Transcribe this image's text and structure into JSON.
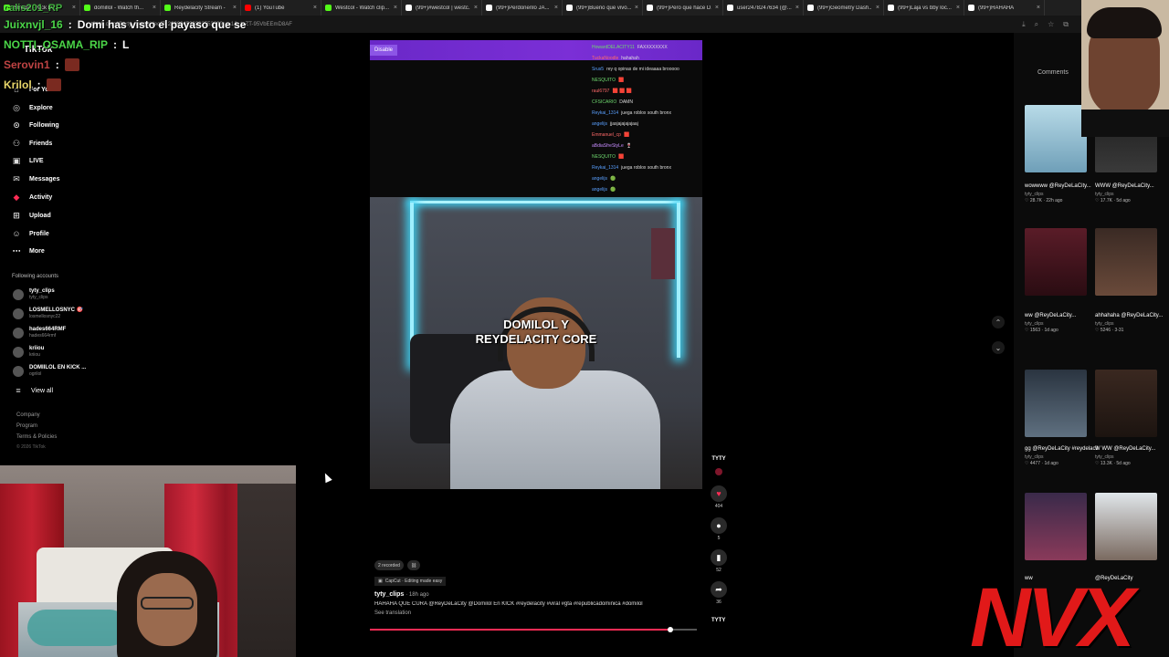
{
  "browser": {
    "tabs": [
      {
        "label": "Stream - Kick D...",
        "color": "#53fc18"
      },
      {
        "label": "domillol - Watch th...",
        "color": "#53fc18"
      },
      {
        "label": "Reydelacity Stream -",
        "color": "#53fc18"
      },
      {
        "label": "(1) YouTube",
        "color": "#ff0000"
      },
      {
        "label": "Westcol - Watch clip...",
        "color": "#53fc18"
      },
      {
        "label": "(99+)#westcol | westc...",
        "color": "#ffffff"
      },
      {
        "label": "(99+)Perdonenlo JA...",
        "color": "#ffffff"
      },
      {
        "label": "(99+)Bueno que vivo...",
        "color": "#ffffff"
      },
      {
        "label": "(99+)Pero que hace D...",
        "color": "#ffffff"
      },
      {
        "label": "user2478247634 (@...",
        "color": "#ffffff"
      },
      {
        "label": "(99+)Geometry Dash...",
        "color": "#ffffff"
      },
      {
        "label": "(99+)Laja vs bby loc...",
        "color": "#ffffff"
      },
      {
        "label": "(99+)HAHAHA",
        "color": "#ffffff"
      }
    ],
    "url": "tiktok.com/@tyty_clips/video/7628090459239255309?_r=1&_t=ZT-95VbEEmD8AF"
  },
  "stream_chat": {
    "top_user": "calis201_RP",
    "lines": [
      {
        "user": "Juixnvjl_16",
        "sep": ":",
        "message": "Domi has visto el payaso que se",
        "style": "green"
      },
      {
        "user": "NOTTI_OSAMA_RIP",
        "sep": ":",
        "message": "L",
        "style": "green"
      },
      {
        "user": "Serovin1",
        "sep": ":",
        "message": "",
        "style": "red",
        "emote": true
      },
      {
        "user": "Krilol",
        "sep": ":",
        "message": "",
        "style": "gold",
        "emote": true
      }
    ],
    "second_user": "NOTTI_OSAMA_RIP",
    "second_msg": "L"
  },
  "sidebar": {
    "logo": "TikTok",
    "items": [
      {
        "label": "For You",
        "icon": "home-icon"
      },
      {
        "label": "Explore",
        "icon": "compass-icon"
      },
      {
        "label": "Following",
        "icon": "following-icon"
      },
      {
        "label": "Friends",
        "icon": "friends-icon"
      },
      {
        "label": "LIVE",
        "icon": "live-icon"
      },
      {
        "label": "Messages",
        "icon": "messages-icon"
      },
      {
        "label": "Activity",
        "icon": "activity-icon"
      },
      {
        "label": "Upload",
        "icon": "upload-icon"
      },
      {
        "label": "Profile",
        "icon": "profile-icon"
      },
      {
        "label": "More",
        "icon": "more-icon"
      }
    ],
    "following_title": "Following accounts",
    "accounts": [
      {
        "name": "tyty_clips",
        "handle": "tyty_clips"
      },
      {
        "name": "LOSMELLOSNYC 🎯",
        "handle": "losmellosnyc22"
      },
      {
        "name": "hades664RMF",
        "handle": "hades664rmf"
      },
      {
        "name": "kriiou",
        "handle": "kriiou"
      },
      {
        "name": "DOMIILOL EN KICK ...",
        "handle": "ogrilol"
      }
    ],
    "view_all": "View all",
    "footer": [
      "Company",
      "Program",
      "Terms & Policies",
      "© 2026 TikTok"
    ]
  },
  "video_chat": {
    "disable_label": "Disable",
    "lines": [
      {
        "user": "HowardDELACITY11",
        "msg": "FAXXXXXXXX",
        "cls": "b"
      },
      {
        "user": "TuckaNoodle",
        "msg": "hahahah",
        "cls": "a"
      },
      {
        "user": "Srus5",
        "msg": "rey q opinas de mi ideaaaa brooooo",
        "cls": ""
      },
      {
        "user": "NESQUITO",
        "msg": "🟥",
        "cls": "b"
      },
      {
        "user": "raul6797",
        "msg": "🟥 🟥 🟥",
        "cls": "a"
      },
      {
        "user": "CFSICARIO",
        "msg": "DAMN",
        "cls": "b"
      },
      {
        "user": "Reykai_1314",
        "msg": "juega roblox south bronx",
        "cls": ""
      },
      {
        "user": "angelijs",
        "msg": "jjasjajajajajaaj",
        "cls": ""
      },
      {
        "user": "Emmanuel_cp",
        "msg": "🟥",
        "cls": "a"
      },
      {
        "user": "aBdiaSfreStyLe",
        "msg": "🍷",
        "cls": "c"
      },
      {
        "user": "NESQUITO",
        "msg": "🟥",
        "cls": "b"
      },
      {
        "user": "Reykai_1314",
        "msg": "juega roblox south bronx",
        "cls": ""
      },
      {
        "user": "angelijs",
        "msg": "🟢",
        "cls": ""
      },
      {
        "user": "angelijs",
        "msg": "🟢",
        "cls": ""
      }
    ]
  },
  "video": {
    "caption_line1": "DOMILOL Y",
    "caption_line2": "REYDELACITY CORE",
    "progress": 0.92
  },
  "actions": {
    "author": "TYTY",
    "likes": "404",
    "comments": "5",
    "saves": "52",
    "shares": "36"
  },
  "description": {
    "chip1": "2 recorded",
    "capcut": "CapCut · Editing made easy",
    "author": "tyty_clips",
    "time": "· 18h ago",
    "text": "HAHAHA QUE CURA @ReyDeLaCity @Domilol En KICK #reydelacity #viral #gta #republicadominica #domilol",
    "translation": "See translation",
    "bottom_tag": "TYTY"
  },
  "right_panel": {
    "title": "Comments",
    "videos": [
      {
        "title": "wowwww @ReyDeLaCity...",
        "author": "tyty_clips",
        "stats": "♡ 28.7K · 22h ago"
      },
      {
        "title": "WWW @ReyDeLaCity...",
        "author": "tyty_clips",
        "stats": "♡ 17.7K · 5d ago"
      },
      {
        "title": "ww @ReyDeLaCity...",
        "author": "tyty_clips",
        "stats": "♡ 1563 · 1d ago"
      },
      {
        "title": "ahhahaha @ReyDeLaCity...",
        "author": "tyty_clips",
        "stats": "♡ 5246 · 3-31"
      },
      {
        "title": "gg @ReyDeLaCity #reydelacity...",
        "author": "tyty_clips",
        "stats": "♡ 4477 · 1d ago"
      },
      {
        "title": "W WW @ReyDeLaCity...",
        "author": "tyty_clips",
        "stats": "♡ 13.3K · 5d ago"
      },
      {
        "title": "ww",
        "author": "",
        "stats": ""
      },
      {
        "title": "@ReyDeLaCity",
        "author": "",
        "stats": ""
      }
    ]
  },
  "watermark": "NVX"
}
